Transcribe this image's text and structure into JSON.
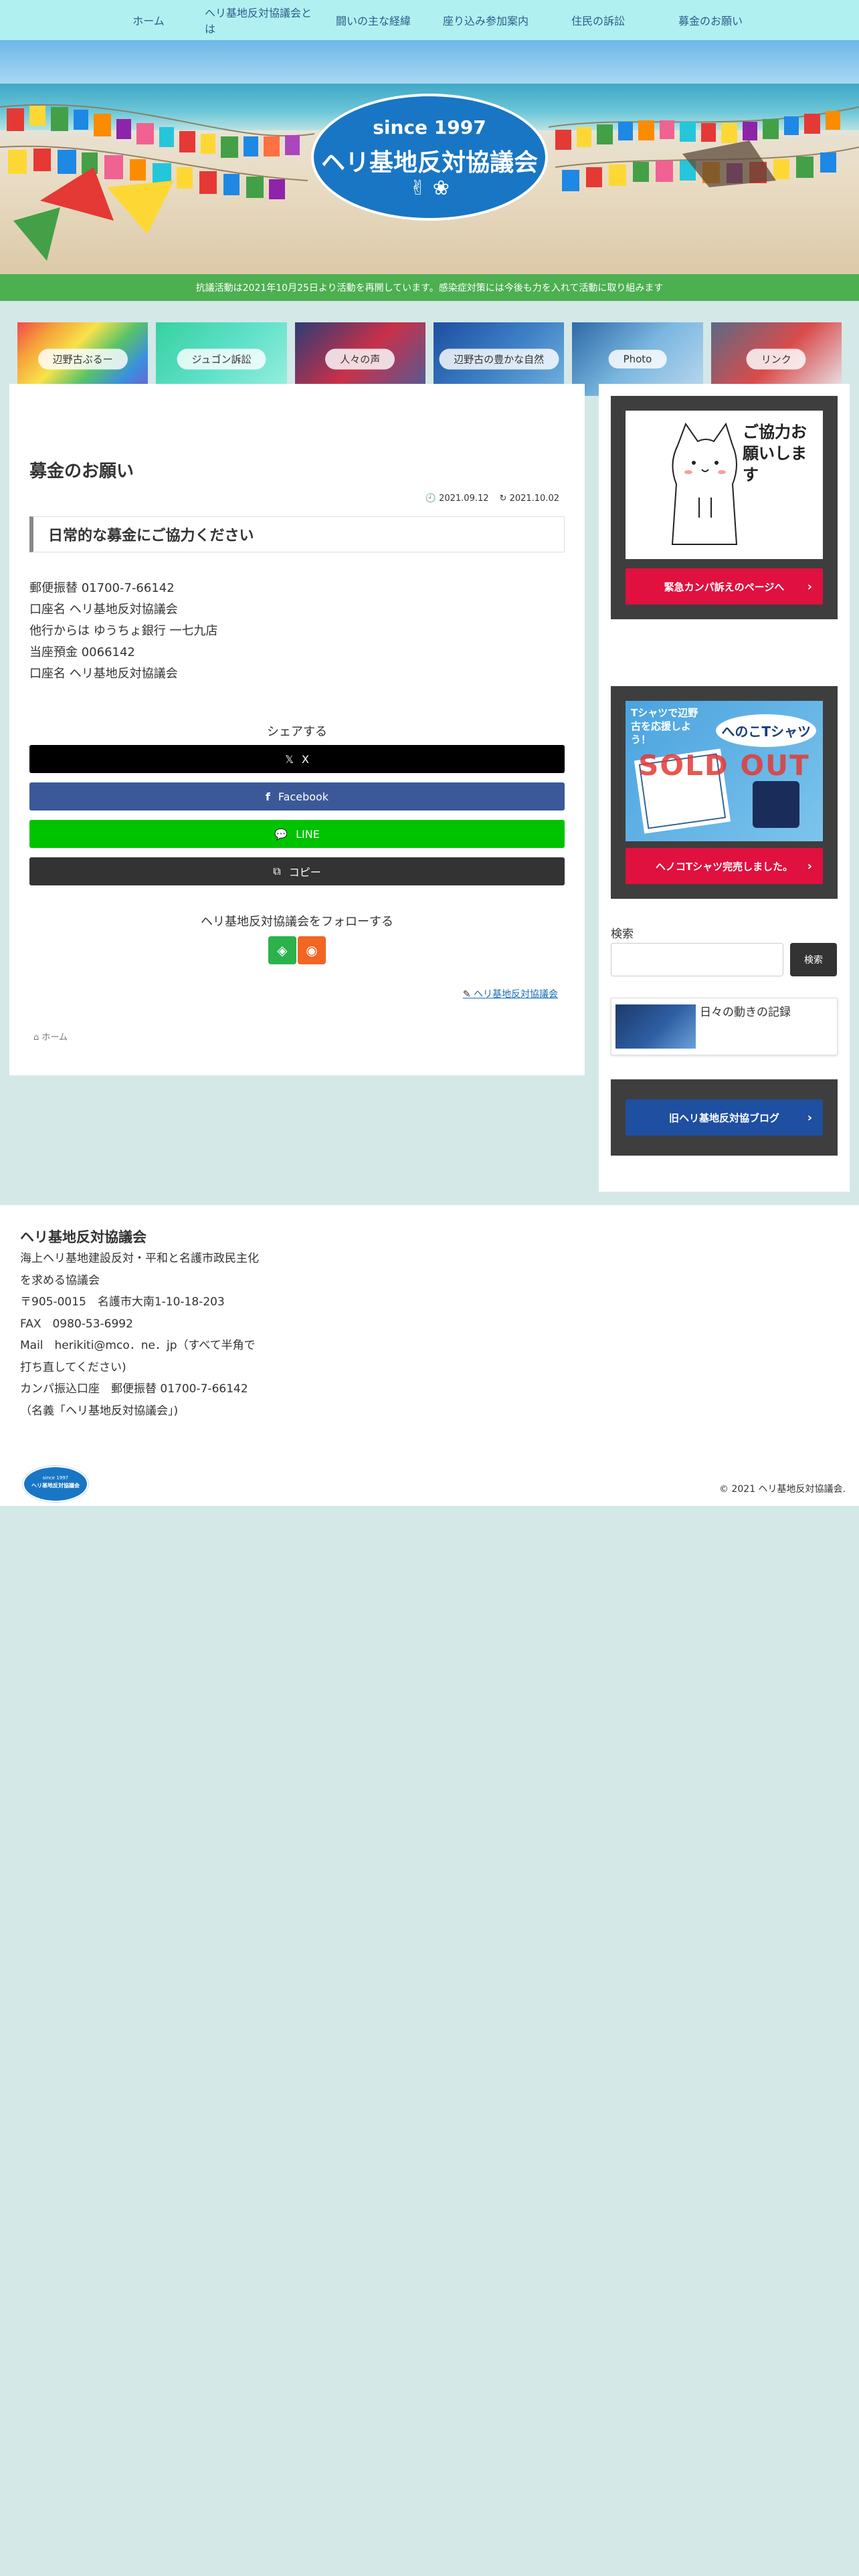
{
  "nav": {
    "items": [
      "ホーム",
      "ヘリ基地反対協議会とは",
      "闘いの主な経緯",
      "座り込み参加案内",
      "住民の訴訟",
      "募金のお願い"
    ]
  },
  "header": {
    "logo_since": "since 1997",
    "logo_name": "ヘリ基地反対協議会"
  },
  "notice": "抗議活動は2021年10月25日より活動を再開しています。感染症対策には今後も力を入れて活動に取り組みます",
  "categories": [
    {
      "label": "辺野古ぶるー",
      "colors": [
        "#f04a4a",
        "#f6a33b",
        "#f7e24a",
        "#58c26a",
        "#3a8fe0",
        "#7b56c9"
      ]
    },
    {
      "label": "ジュゴン訴訟",
      "colors": [
        "#36d1a0",
        "#5ee0c8",
        "#9af0e0"
      ]
    },
    {
      "label": "人々の声",
      "colors": [
        "#2b3d75",
        "#c9304a",
        "#4a5f9a"
      ]
    },
    {
      "label": "辺野古の豊かな自然",
      "colors": [
        "#1d4fa0",
        "#3c7ec4",
        "#74b3df"
      ]
    },
    {
      "label": "Photo",
      "colors": [
        "#2d6aa6",
        "#7bb7e0",
        "#bcd8ef"
      ]
    },
    {
      "label": "リンク",
      "colors": [
        "#5b6a86",
        "#d94b4b",
        "#e9eef3"
      ]
    }
  ],
  "article": {
    "title": "募金のお願い",
    "published": "2021.09.12",
    "updated": "2021.10.02",
    "heading": "日常的な募金にご協力ください",
    "lines": [
      "郵便振替 01700-7-66142",
      "口座名 ヘリ基地反対協議会",
      "他行からは ゆうちょ銀行 一七九店",
      "当座預金 0066142",
      "口座名 ヘリ基地反対協議会"
    ],
    "share_title": "シェアする",
    "share_buttons": [
      {
        "label": "X",
        "color": "#000000"
      },
      {
        "label": "Facebook",
        "color": "#3b5998"
      },
      {
        "label": "LINE",
        "color": "#00c300"
      },
      {
        "label": "コピー",
        "color": "#333333"
      }
    ],
    "follow_title": "ヘリ基地反対協議会をフォローする",
    "author": "ヘリ基地反対協議会",
    "breadcrumb": "ホーム"
  },
  "sidebar": {
    "widget1": {
      "button": "緊急カンパ訴えのページへ",
      "img_text": "ご協力お願いします",
      "btn_color": "#e0103f"
    },
    "widget2": {
      "button": "ヘノコTシャツ完売しました。",
      "img_top": "Tシャツで辺野古を応援しよう！",
      "img_badge": "SOLD OUT",
      "img_title": "へのこTシャツ",
      "btn_color": "#e0103f"
    },
    "search": {
      "label": "検索",
      "button": "検索"
    },
    "post": {
      "title": "日々の動きの記録"
    },
    "widget3": {
      "button": "旧ヘリ基地反対協ブログ",
      "btn_color": "#1e4fa0"
    }
  },
  "footer": {
    "title": "ヘリ基地反対協議会",
    "lines": [
      "海上ヘリ基地建設反対・平和と名護市政民主化",
      "を求める協議会",
      "〒905-0015　名護市大南1-10-18-203",
      "FAX　0980-53-6992",
      "Mail　herikiti@mco．ne．jp（すべて半角で",
      "打ち直してください)",
      "カンパ振込口座　郵便振替 01700-7-66142",
      "（名義「ヘリ基地反対協議会」)"
    ],
    "logo_since": "since 1997",
    "logo_name": "ヘリ基地反対協議会",
    "copyright": "© 2021 ヘリ基地反対協議会."
  }
}
